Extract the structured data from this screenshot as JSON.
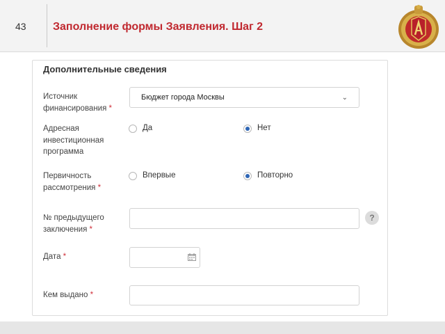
{
  "header": {
    "slide_number": "43",
    "title": "Заполнение формы Заявления. Шаг 2"
  },
  "form": {
    "section_title": "Дополнительные сведения",
    "funding_source": {
      "label": "Источник финансирования",
      "required_mark": "*",
      "value": "Бюджет города Москвы"
    },
    "address_program": {
      "label": "Адресная инвестиционная программа",
      "options": [
        "Да",
        "Нет"
      ],
      "selected": "Нет"
    },
    "review_primacy": {
      "label": "Первичность рассмотрения",
      "required_mark": "*",
      "options": [
        "Впервые",
        "Повторно"
      ],
      "selected": "Повторно"
    },
    "previous_conclusion": {
      "label": "№ предыдущего заключения",
      "required_mark": "*",
      "value": "",
      "help": "?"
    },
    "date": {
      "label": "Дата",
      "required_mark": "*",
      "value": ""
    },
    "issued_by": {
      "label": "Кем выдано",
      "required_mark": "*",
      "value": ""
    }
  },
  "colors": {
    "title_red": "#c0282f",
    "radio_blue": "#2e66b5",
    "required_red": "#d0303a"
  },
  "icons": [
    "emblem-icon",
    "calendar-icon",
    "help-icon",
    "caret-down-icon"
  ]
}
